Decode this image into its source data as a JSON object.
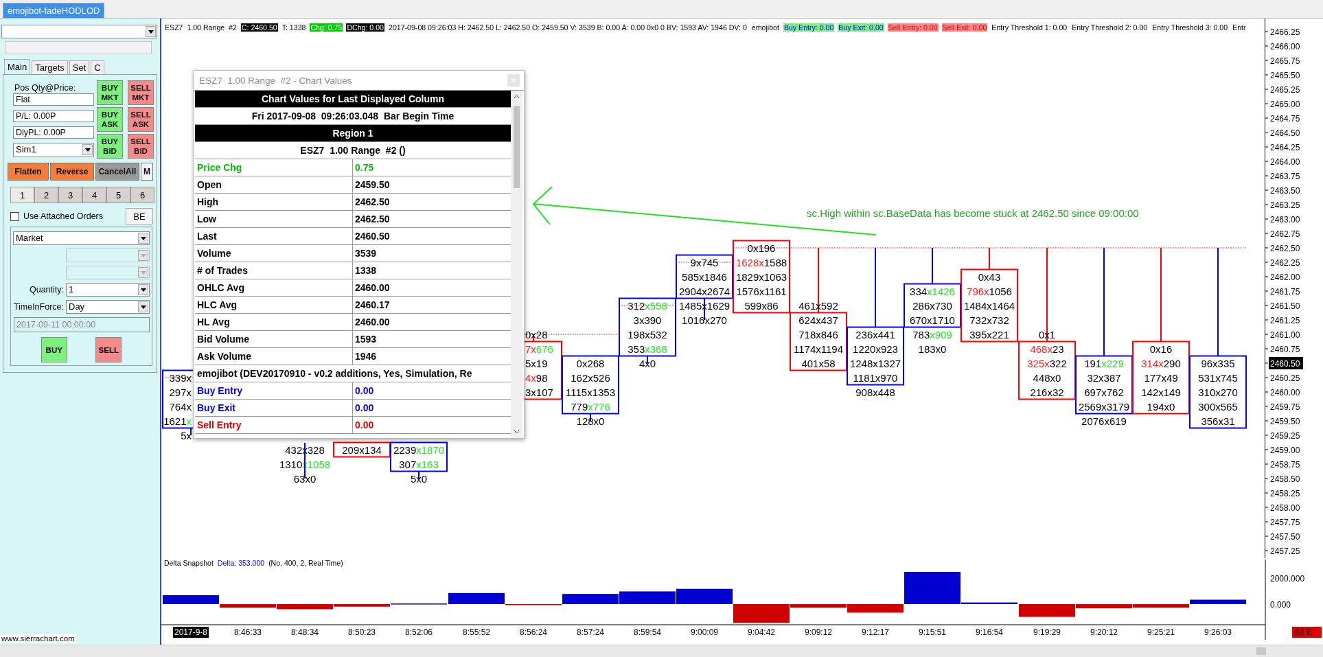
{
  "app_tab": {
    "label": "emojibot-fadeHODLOD",
    "selected": true
  },
  "trade_panel": {
    "tabs": [
      {
        "label": "Main",
        "selected": true
      },
      {
        "label": "Targets",
        "selected": false
      },
      {
        "label": "Set",
        "selected": false
      },
      {
        "label": "C",
        "selected": false
      }
    ],
    "position_label": "Pos Qty@Price:",
    "fields": [
      "Flat",
      "P/L: 0.00P",
      "DlyPL: 0.00P"
    ],
    "account": "Sim1",
    "order_buttons": [
      {
        "label": "BUY MKT",
        "kind": "buy"
      },
      {
        "label": "SELL MKT",
        "kind": "sell"
      },
      {
        "label": "BUY ASK",
        "kind": "buy"
      },
      {
        "label": "SELL ASK",
        "kind": "sell"
      },
      {
        "label": "BUY BID",
        "kind": "buy"
      },
      {
        "label": "SELL BID",
        "kind": "sell"
      }
    ],
    "action_buttons": [
      {
        "label": "Flatten",
        "kind": "action"
      },
      {
        "label": "Reverse",
        "kind": "action"
      },
      {
        "label": "CancelAll",
        "kind": "cancel"
      },
      {
        "label": "M",
        "kind": "plain"
      }
    ],
    "slots": [
      {
        "label": "1",
        "selected": true
      },
      {
        "label": "2",
        "selected": false
      },
      {
        "label": "3",
        "selected": false
      },
      {
        "label": "4",
        "selected": false
      },
      {
        "label": "5",
        "selected": false
      },
      {
        "label": "6",
        "selected": false
      }
    ],
    "attached_orders": {
      "label": "Use Attached Orders",
      "checked": false
    },
    "be_button": "BE",
    "order_type": "Market",
    "extra_combos": [
      {
        "disabled": true
      },
      {
        "disabled": true
      }
    ],
    "quantity": {
      "label": "Quantity:",
      "value": "1"
    },
    "time_in_force": {
      "label": "TimeInForce:",
      "value": "Day"
    },
    "expiry": {
      "value": "2017-09-11  00:00:00",
      "disabled": true
    },
    "submit_buttons": [
      {
        "label": "BUY",
        "kind": "buy"
      },
      {
        "label": "SELL",
        "kind": "sell"
      }
    ]
  },
  "chart": {
    "header": [
      {
        "text": "ESZ7  1.00 Range  #2",
        "kind": "plain"
      },
      {
        "text": "C: 2460.50",
        "kind": "inverse"
      },
      {
        "text": "T: 1338",
        "kind": "plain"
      },
      {
        "text": "Chg: 0.75",
        "kind": "positive"
      },
      {
        "text": "DChg: 0.00",
        "kind": "inverse"
      },
      {
        "text": "2017-09-08 09:26:03 H: 2462.50 L: 2462.50 O: 2459.50 V: 3539 B: 0.00 A: 0.00 0x0 0 BV: 1593 AV: 1946 DV: 0",
        "kind": "plain"
      },
      {
        "text": "emojibot",
        "kind": "plain"
      },
      {
        "text": "Buy Entry: 0.00",
        "kind": "buy"
      },
      {
        "text": "Buy Exit: 0.00",
        "kind": "buy"
      },
      {
        "text": "Sell Entry: 0.00",
        "kind": "sell"
      },
      {
        "text": "Sell Exit: 0.00",
        "kind": "sell"
      },
      {
        "text": "Entry Threshold 1: 0.00",
        "kind": "plain"
      },
      {
        "text": "Entry Threshold 2: 0.00",
        "kind": "plain"
      },
      {
        "text": "Entry Threshold 3: 0.00",
        "kind": "plain"
      },
      {
        "text": "Entr",
        "kind": "plain"
      }
    ],
    "columns": [
      {
        "kind": "rightcut",
        "color": "#0000ff",
        "levels": [
          {
            "kind": "blank"
          },
          {
            "kind": "blank"
          },
          {
            "kind": "blank"
          },
          {
            "kind": "blank"
          },
          {
            "kind": "blank"
          },
          {
            "kind": "blank"
          },
          {
            "kind": "blank"
          },
          {
            "kind": "blank"
          },
          {
            "kind": "blank"
          },
          {
            "kind": "body",
            "text": "339x"
          },
          {
            "kind": "body",
            "text": "297x"
          },
          {
            "kind": "body",
            "text": "764x"
          },
          {
            "kind": "body",
            "parts": [
              {
                "text": "1621"
              },
              {
                "text": "x",
                "color": "#1ee81e"
              }
            ]
          },
          {
            "kind": "wick",
            "text": "5x"
          }
        ]
      },
      {
        "kind": "hidden"
      },
      {
        "kind": "full",
        "color": "#0000ff",
        "levels": [
          {
            "kind": "blank"
          },
          {
            "kind": "blank"
          },
          {
            "kind": "blank"
          },
          {
            "kind": "blank"
          },
          {
            "kind": "blank"
          },
          {
            "kind": "blank"
          },
          {
            "kind": "blank"
          },
          {
            "kind": "blank"
          },
          {
            "kind": "blank"
          },
          {
            "kind": "blank"
          },
          {
            "kind": "blank"
          },
          {
            "kind": "blank"
          },
          {
            "kind": "blank"
          },
          {
            "kind": "blank"
          },
          {
            "kind": "wick",
            "text": "432x328"
          },
          {
            "kind": "wick",
            "parts": [
              {
                "text": "1310"
              },
              {
                "text": "x1058",
                "color": "#1ee81e"
              }
            ]
          },
          {
            "kind": "wick",
            "text": "63x0"
          }
        ]
      },
      {
        "kind": "full",
        "color": "#ff0000",
        "levels": [
          {
            "kind": "blank"
          },
          {
            "kind": "blank"
          },
          {
            "kind": "blank"
          },
          {
            "kind": "blank"
          },
          {
            "kind": "blank"
          },
          {
            "kind": "blank"
          },
          {
            "kind": "blank"
          },
          {
            "kind": "blank"
          },
          {
            "kind": "blank"
          },
          {
            "kind": "blank"
          },
          {
            "kind": "blank"
          },
          {
            "kind": "blank"
          },
          {
            "kind": "blank"
          },
          {
            "kind": "blank"
          },
          {
            "kind": "body",
            "text": "209x134"
          }
        ]
      },
      {
        "kind": "full",
        "color": "#0000ff",
        "levels": [
          {
            "kind": "blank"
          },
          {
            "kind": "blank"
          },
          {
            "kind": "blank"
          },
          {
            "kind": "blank"
          },
          {
            "kind": "blank"
          },
          {
            "kind": "blank"
          },
          {
            "kind": "blank"
          },
          {
            "kind": "blank"
          },
          {
            "kind": "blank"
          },
          {
            "kind": "blank"
          },
          {
            "kind": "blank"
          },
          {
            "kind": "blank"
          },
          {
            "kind": "blank"
          },
          {
            "kind": "blank"
          },
          {
            "kind": "body",
            "parts": [
              {
                "text": "2239"
              },
              {
                "text": "x1870",
                "color": "#1ee81e"
              }
            ]
          },
          {
            "kind": "body",
            "parts": [
              {
                "text": "307"
              },
              {
                "text": "x163",
                "color": "#1ee81e"
              }
            ]
          },
          {
            "kind": "wick",
            "text": "5x0"
          }
        ]
      },
      {
        "kind": "hidden"
      },
      {
        "kind": "leftcut",
        "color": "#ff0000",
        "levels": [
          {
            "kind": "blank"
          },
          {
            "kind": "blank"
          },
          {
            "kind": "blank"
          },
          {
            "kind": "blank"
          },
          {
            "kind": "blank"
          },
          {
            "kind": "blank"
          },
          {
            "kind": "wick",
            "text": "0x28"
          },
          {
            "kind": "body",
            "parts": [
              {
                "text": "7x",
                "color": "#ff2020"
              },
              {
                "text": "676",
                "color": "#1ee81e"
              }
            ]
          },
          {
            "kind": "body",
            "text": "5x19"
          },
          {
            "kind": "body",
            "parts": [
              {
                "text": "4x",
                "color": "#ff2020"
              },
              {
                "text": "98"
              }
            ]
          },
          {
            "kind": "body",
            "text": "3x107"
          }
        ]
      },
      {
        "kind": "full",
        "color": "#0000ff",
        "levels": [
          {
            "kind": "blank"
          },
          {
            "kind": "blank"
          },
          {
            "kind": "blank"
          },
          {
            "kind": "blank"
          },
          {
            "kind": "blank"
          },
          {
            "kind": "blank"
          },
          {
            "kind": "blank"
          },
          {
            "kind": "blank"
          },
          {
            "kind": "body",
            "text": "0x268"
          },
          {
            "kind": "body",
            "text": "162x526"
          },
          {
            "kind": "body",
            "text": "1115x1353"
          },
          {
            "kind": "body",
            "parts": [
              {
                "text": "779"
              },
              {
                "text": "x776",
                "color": "#1ee81e"
              }
            ]
          },
          {
            "kind": "wick",
            "text": "128x0"
          }
        ]
      },
      {
        "kind": "full",
        "color": "#0000ff",
        "levels": [
          {
            "kind": "blank"
          },
          {
            "kind": "blank"
          },
          {
            "kind": "blank"
          },
          {
            "kind": "blank"
          },
          {
            "kind": "body",
            "parts": [
              {
                "text": "312"
              },
              {
                "text": "x558",
                "color": "#1ee81e"
              }
            ]
          },
          {
            "kind": "body",
            "text": "3x390"
          },
          {
            "kind": "body",
            "text": "198x532"
          },
          {
            "kind": "body",
            "parts": [
              {
                "text": "353"
              },
              {
                "text": "x368",
                "color": "#1ee81e"
              }
            ]
          },
          {
            "kind": "wick",
            "text": "4x0"
          }
        ]
      },
      {
        "kind": "full",
        "color": "#0000ff",
        "levels": [
          {
            "kind": "blank"
          },
          {
            "kind": "body",
            "text": "9x745"
          },
          {
            "kind": "body",
            "text": "585x1846"
          },
          {
            "kind": "body",
            "text": "2904x2674"
          },
          {
            "kind": "wick",
            "text": "1485x1629"
          },
          {
            "kind": "wick",
            "text": "1016x270"
          }
        ]
      },
      {
        "kind": "full",
        "color": "#ff0000",
        "levels": [
          {
            "kind": "body",
            "text": "0x196"
          },
          {
            "kind": "body",
            "parts": [
              {
                "text": "1628x",
                "color": "#ff2020"
              },
              {
                "text": "1588"
              }
            ]
          },
          {
            "kind": "body",
            "text": "1829x1063"
          },
          {
            "kind": "body",
            "text": "1576x1161"
          },
          {
            "kind": "body",
            "text": "599x86"
          }
        ]
      },
      {
        "kind": "full",
        "color": "#ff0000",
        "levels": [
          {
            "kind": "wick"
          },
          {
            "kind": "wick"
          },
          {
            "kind": "wick"
          },
          {
            "kind": "wick"
          },
          {
            "kind": "wick",
            "text": "461x592"
          },
          {
            "kind": "body",
            "text": "624x437"
          },
          {
            "kind": "body",
            "text": "718x846"
          },
          {
            "kind": "body",
            "text": "1174x1194"
          },
          {
            "kind": "body",
            "text": "401x58"
          }
        ]
      },
      {
        "kind": "full",
        "color": "#0000ff",
        "levels": [
          {
            "kind": "wick"
          },
          {
            "kind": "wick"
          },
          {
            "kind": "wick"
          },
          {
            "kind": "wick"
          },
          {
            "kind": "wick"
          },
          {
            "kind": "wick"
          },
          {
            "kind": "body",
            "text": "236x441"
          },
          {
            "kind": "body",
            "text": "1220x923"
          },
          {
            "kind": "body",
            "text": "1248x1327"
          },
          {
            "kind": "body",
            "text": "1181x970"
          },
          {
            "kind": "plain",
            "text": "908x448"
          }
        ]
      },
      {
        "kind": "full",
        "color": "#0000ff",
        "levels": [
          {
            "kind": "wick"
          },
          {
            "kind": "wick"
          },
          {
            "kind": "wick"
          },
          {
            "kind": "body",
            "parts": [
              {
                "text": "334"
              },
              {
                "text": "x1426",
                "color": "#1ee81e"
              }
            ]
          },
          {
            "kind": "body",
            "text": "286x730"
          },
          {
            "kind": "body",
            "text": "670x1710"
          },
          {
            "kind": "plain",
            "parts": [
              {
                "text": "783"
              },
              {
                "text": "x909",
                "color": "#1ee81e"
              }
            ]
          },
          {
            "kind": "plain",
            "text": "183x0"
          }
        ]
      },
      {
        "kind": "full",
        "color": "#ff0000",
        "levels": [
          {
            "kind": "wick"
          },
          {
            "kind": "wick"
          },
          {
            "kind": "body",
            "text": "0x43"
          },
          {
            "kind": "body",
            "parts": [
              {
                "text": "796x",
                "color": "#ff2020"
              },
              {
                "text": "1056"
              }
            ]
          },
          {
            "kind": "body",
            "text": "1484x1464"
          },
          {
            "kind": "body",
            "text": "732x732"
          },
          {
            "kind": "body",
            "text": "395x221"
          }
        ]
      },
      {
        "kind": "full",
        "color": "#ff0000",
        "levels": [
          {
            "kind": "wick"
          },
          {
            "kind": "wick"
          },
          {
            "kind": "wick"
          },
          {
            "kind": "wick"
          },
          {
            "kind": "wick"
          },
          {
            "kind": "wick"
          },
          {
            "kind": "wick",
            "text": "0x1"
          },
          {
            "kind": "body",
            "parts": [
              {
                "text": "468x",
                "color": "#ff2020"
              },
              {
                "text": "23"
              }
            ]
          },
          {
            "kind": "body",
            "parts": [
              {
                "text": "325x",
                "color": "#ff2020"
              },
              {
                "text": "322"
              }
            ]
          },
          {
            "kind": "body",
            "text": "448x0"
          },
          {
            "kind": "body",
            "text": "216x32"
          }
        ]
      },
      {
        "kind": "full",
        "color": "#0000ff",
        "levels": [
          {
            "kind": "wick"
          },
          {
            "kind": "wick"
          },
          {
            "kind": "wick"
          },
          {
            "kind": "wick"
          },
          {
            "kind": "wick"
          },
          {
            "kind": "wick"
          },
          {
            "kind": "wick"
          },
          {
            "kind": "wick"
          },
          {
            "kind": "body",
            "parts": [
              {
                "text": "191"
              },
              {
                "text": "x229",
                "color": "#1ee81e"
              }
            ]
          },
          {
            "kind": "body",
            "text": "32x387"
          },
          {
            "kind": "body",
            "text": "697x762"
          },
          {
            "kind": "body",
            "text": "2569x3179"
          },
          {
            "kind": "plain",
            "text": "2076x619"
          }
        ]
      },
      {
        "kind": "full",
        "color": "#ff0000",
        "levels": [
          {
            "kind": "wick"
          },
          {
            "kind": "wick"
          },
          {
            "kind": "wick"
          },
          {
            "kind": "wick"
          },
          {
            "kind": "wick"
          },
          {
            "kind": "wick"
          },
          {
            "kind": "wick"
          },
          {
            "kind": "body",
            "text": "0x16"
          },
          {
            "kind": "body",
            "parts": [
              {
                "text": "314x",
                "color": "#ff2020"
              },
              {
                "text": "290"
              }
            ]
          },
          {
            "kind": "body",
            "text": "177x49"
          },
          {
            "kind": "body",
            "text": "142x149"
          },
          {
            "kind": "body",
            "text": "194x0"
          }
        ]
      },
      {
        "kind": "full",
        "color": "#0000ff",
        "levels": [
          {
            "kind": "wick"
          },
          {
            "kind": "wick"
          },
          {
            "kind": "wick"
          },
          {
            "kind": "wick"
          },
          {
            "kind": "wick"
          },
          {
            "kind": "wick"
          },
          {
            "kind": "wick"
          },
          {
            "kind": "wick"
          },
          {
            "kind": "body",
            "text": "96x335"
          },
          {
            "kind": "body",
            "text": "531x745"
          },
          {
            "kind": "body",
            "text": "310x270"
          },
          {
            "kind": "body",
            "text": "300x565"
          },
          {
            "kind": "body",
            "text": "356x31"
          }
        ]
      }
    ],
    "price_axis": [
      {
        "text": "2466.25",
        "current": false
      },
      {
        "text": "2466.00",
        "current": false
      },
      {
        "text": "2465.75",
        "current": false
      },
      {
        "text": "2465.50",
        "current": false
      },
      {
        "text": "2465.25",
        "current": false
      },
      {
        "text": "2465.00",
        "current": false
      },
      {
        "text": "2464.75",
        "current": false
      },
      {
        "text": "2464.50",
        "current": false
      },
      {
        "text": "2464.25",
        "current": false
      },
      {
        "text": "2464.00",
        "current": false
      },
      {
        "text": "2463.75",
        "current": false
      },
      {
        "text": "2463.50",
        "current": false
      },
      {
        "text": "2463.25",
        "current": false
      },
      {
        "text": "2463.00",
        "current": false
      },
      {
        "text": "2462.75",
        "current": false
      },
      {
        "text": "2462.50",
        "current": false
      },
      {
        "text": "2462.25",
        "current": false
      },
      {
        "text": "2462.00",
        "current": false
      },
      {
        "text": "2461.75",
        "current": false
      },
      {
        "text": "2461.50",
        "current": false
      },
      {
        "text": "2461.25",
        "current": false
      },
      {
        "text": "2461.00",
        "current": false
      },
      {
        "text": "2460.75",
        "current": false
      },
      {
        "text": "2460.50",
        "current": true
      },
      {
        "text": "2460.25",
        "current": false
      },
      {
        "text": "2460.00",
        "current": false
      },
      {
        "text": "2459.75",
        "current": false
      },
      {
        "text": "2459.50",
        "current": false
      },
      {
        "text": "2459.25",
        "current": false
      },
      {
        "text": "2459.00",
        "current": false
      },
      {
        "text": "2458.75",
        "current": false
      },
      {
        "text": "2458.50",
        "current": false
      },
      {
        "text": "2458.25",
        "current": false
      },
      {
        "text": "2458.00",
        "current": false
      },
      {
        "text": "2457.75",
        "current": false
      },
      {
        "text": "2457.50",
        "current": false
      },
      {
        "text": "2457.25",
        "current": false
      }
    ],
    "annotation": "sc.High within sc.BaseData has become stuck at 2462.50 since 09:00:00",
    "delta": {
      "legend": [
        {
          "text": "Delta Snapshot",
          "kind": "plain"
        },
        {
          "text": "Delta: 353.000",
          "kind": "value"
        },
        {
          "text": "(No, 400, 2, Real Time)",
          "kind": "plain"
        }
      ],
      "first_label_boxed": true,
      "chart_data": {
        "type": "bar",
        "categories": [
          "2017-9-8",
          "8:46:33",
          "8:48:34",
          "8:50:23",
          "8:52:06",
          "8:55:52",
          "8:56:24",
          "8:57:24",
          "8:59:54",
          "9:00:09",
          "9:04:42",
          "9:09:12",
          "9:12:17",
          "9:15:51",
          "9:16:54",
          "9:19:29",
          "9:20:12",
          "9:25:21",
          "9:26:03"
        ],
        "values": [
          700,
          -270,
          -400,
          -200,
          50,
          870,
          -30,
          800,
          1000,
          1200,
          -1470,
          -270,
          -670,
          2530,
          130,
          -1000,
          -330,
          -270,
          350
        ],
        "ylim": [
          -2800,
          3500
        ],
        "yticks": [
          {
            "value": 2000,
            "label": "2000.000"
          },
          {
            "value": 0,
            "label": "0.000"
          }
        ]
      }
    },
    "scale_badge": "82 E"
  },
  "popup": {
    "title": "ESZ7  1.00 Range  #2 - Chart Values",
    "rows": [
      {
        "kind": "banner",
        "text": "Chart Values for Last Displayed Column"
      },
      {
        "kind": "title",
        "text": "Fri 2017-09-08  09:26:03.048  Bar Begin Time"
      },
      {
        "kind": "banner",
        "text": "Region 1"
      },
      {
        "kind": "title",
        "text": "ESZ7  1.00 Range  #2 ()"
      },
      {
        "kind": "pair",
        "label": "Price Chg",
        "value": "0.75",
        "color": "#00c000"
      },
      {
        "kind": "pair",
        "label": "Open",
        "value": "2459.50"
      },
      {
        "kind": "pair",
        "label": "High",
        "value": "2462.50"
      },
      {
        "kind": "pair",
        "label": "Low",
        "value": "2462.50"
      },
      {
        "kind": "pair",
        "label": "Last",
        "value": "2460.50"
      },
      {
        "kind": "pair",
        "label": "Volume",
        "value": "3539"
      },
      {
        "kind": "pair",
        "label": "# of Trades",
        "value": "1338"
      },
      {
        "kind": "pair",
        "label": "OHLC Avg",
        "value": "2460.00"
      },
      {
        "kind": "pair",
        "label": "HLC Avg",
        "value": "2460.17"
      },
      {
        "kind": "pair",
        "label": "HL Avg",
        "value": "2460.00"
      },
      {
        "kind": "pair",
        "label": "Bid Volume",
        "value": "1593"
      },
      {
        "kind": "pair",
        "label": "Ask Volume",
        "value": "1946"
      },
      {
        "kind": "wide",
        "text": "emojibot (DEV20170910 - v0.2 additions, Yes, Simulation, Re"
      },
      {
        "kind": "pair",
        "label": "Buy Entry",
        "value": "0.00",
        "color": "#0000e0"
      },
      {
        "kind": "pair",
        "label": "Buy Exit",
        "value": "0.00",
        "color": "#0000e0"
      },
      {
        "kind": "pair",
        "label": "Sell Entry",
        "value": "0.00",
        "color": "#e00000"
      }
    ]
  },
  "footer": {
    "site": "www.sierrachart.com"
  }
}
